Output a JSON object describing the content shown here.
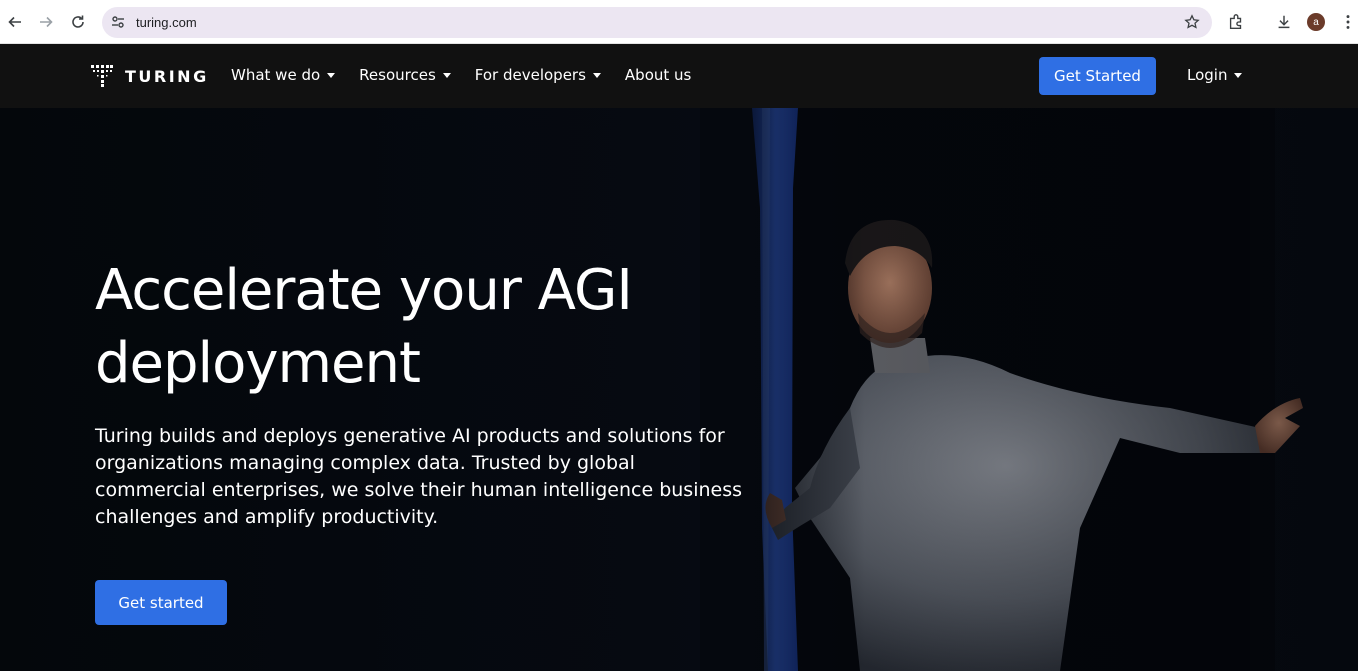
{
  "browser": {
    "url": "turing.com",
    "profile_initial": "a",
    "icons": [
      "back-icon",
      "forward-icon",
      "reload-icon",
      "site-info-icon",
      "bookmark-star-icon",
      "extensions-icon",
      "download-icon",
      "menu-icon"
    ]
  },
  "header": {
    "brand": "TURING",
    "nav": [
      {
        "label": "What we do",
        "has_dropdown": true
      },
      {
        "label": "Resources",
        "has_dropdown": true
      },
      {
        "label": "For developers",
        "has_dropdown": true
      },
      {
        "label": "About us",
        "has_dropdown": false
      }
    ],
    "cta_label": "Get Started",
    "login_label": "Login"
  },
  "hero": {
    "title": "Accelerate your AGI deployment",
    "description": "Turing builds and deploys generative AI products and solutions for organizations managing complex data. Trusted by global commercial enterprises, we solve their human intelligence business challenges and amplify productivity.",
    "cta_label": "Get started"
  },
  "colors": {
    "accent": "#2f6fe4",
    "header_bg": "#111111",
    "hero_bg": "#05070c"
  }
}
